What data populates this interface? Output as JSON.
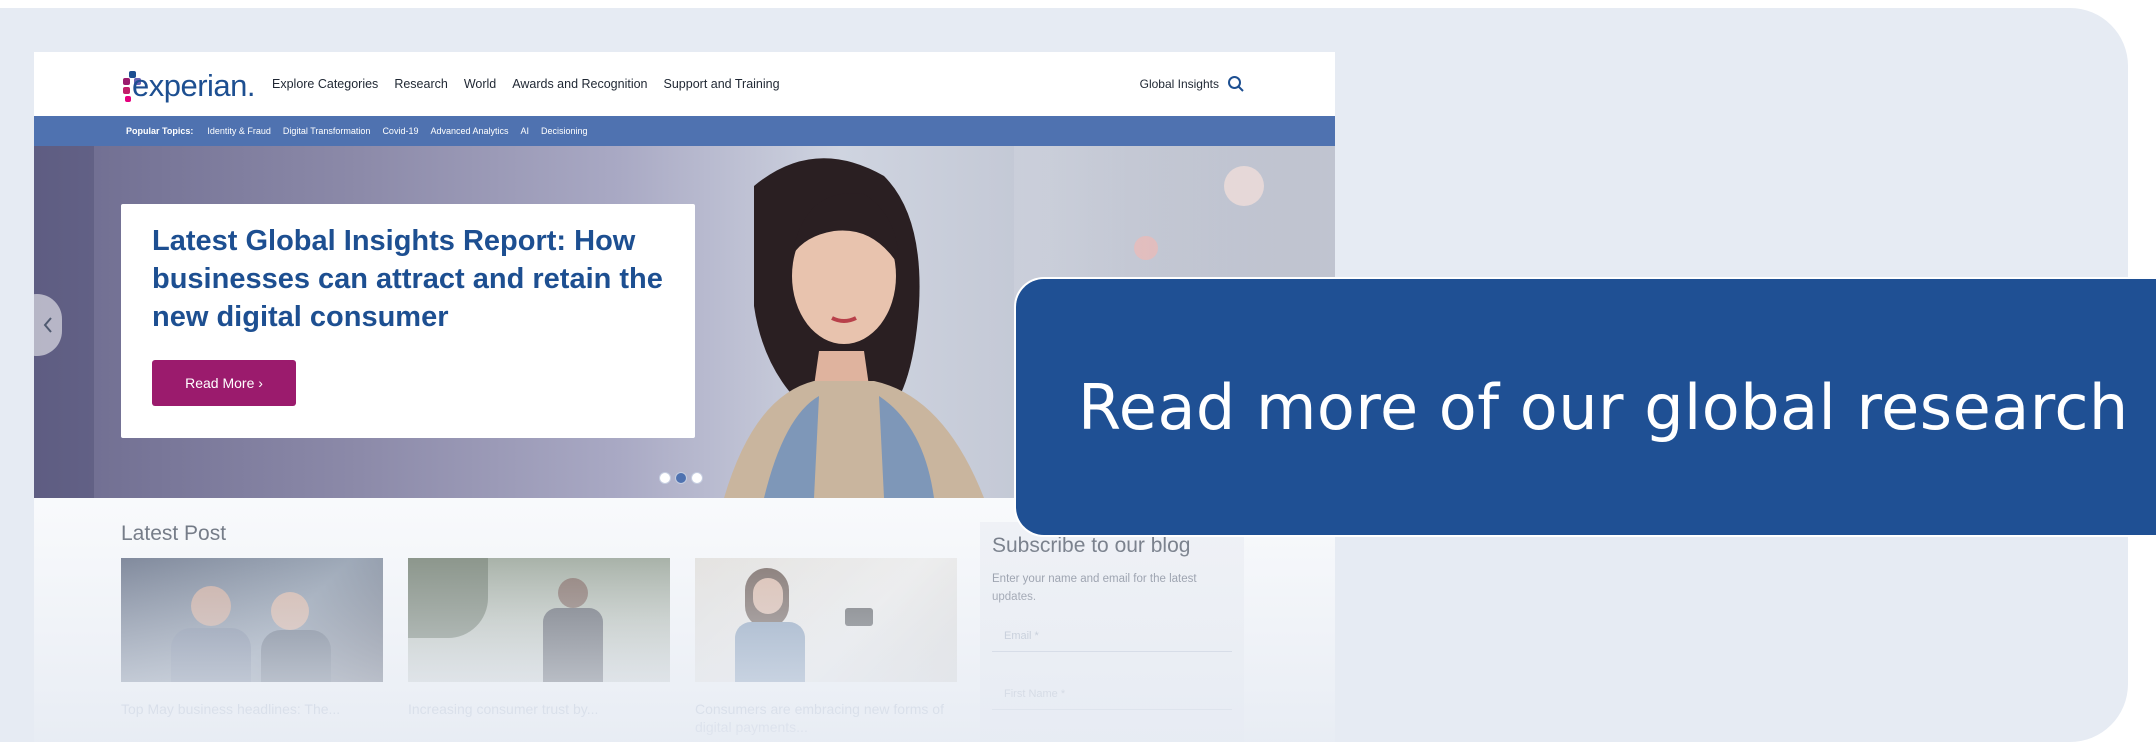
{
  "brand": {
    "logo_text": "experian.",
    "logo_dot_colors": [
      "#1d4f91",
      "#9b1b6d",
      "#6a63b5",
      "#c11e6a",
      "#e5007d"
    ],
    "primary_color": "#1d4f91",
    "accent_color": "#9b1b6d",
    "banner_color": "#1f5094"
  },
  "header": {
    "nav": [
      "Explore Categories",
      "Research",
      "World",
      "Awards and Recognition",
      "Support and Training"
    ],
    "global_insights": "Global Insights",
    "search_icon": "search-icon"
  },
  "topics": {
    "label": "Popular Topics:",
    "items": [
      "Identity & Fraud",
      "Digital Transformation",
      "Covid-19",
      "Advanced Analytics",
      "AI",
      "Decisioning"
    ]
  },
  "hero": {
    "title": "Latest Global Insights Report: How businesses can attract and retain the new digital consumer",
    "button": "Read More ›",
    "slides": 3,
    "active_slide": 2,
    "prev_icon": "chevron-left-icon"
  },
  "latest": {
    "heading": "Latest Post",
    "posts": [
      {
        "title": "Top May business headlines: The..."
      },
      {
        "title": "Increasing consumer trust by..."
      },
      {
        "title": "Consumers are embracing new forms of digital payments..."
      }
    ]
  },
  "subscribe": {
    "title": "Subscribe to our blog",
    "description": "Enter your name and email for the latest updates.",
    "email_placeholder": "Email *",
    "name_placeholder": "First Name *"
  },
  "cta": {
    "text": "Read more of our global research"
  }
}
